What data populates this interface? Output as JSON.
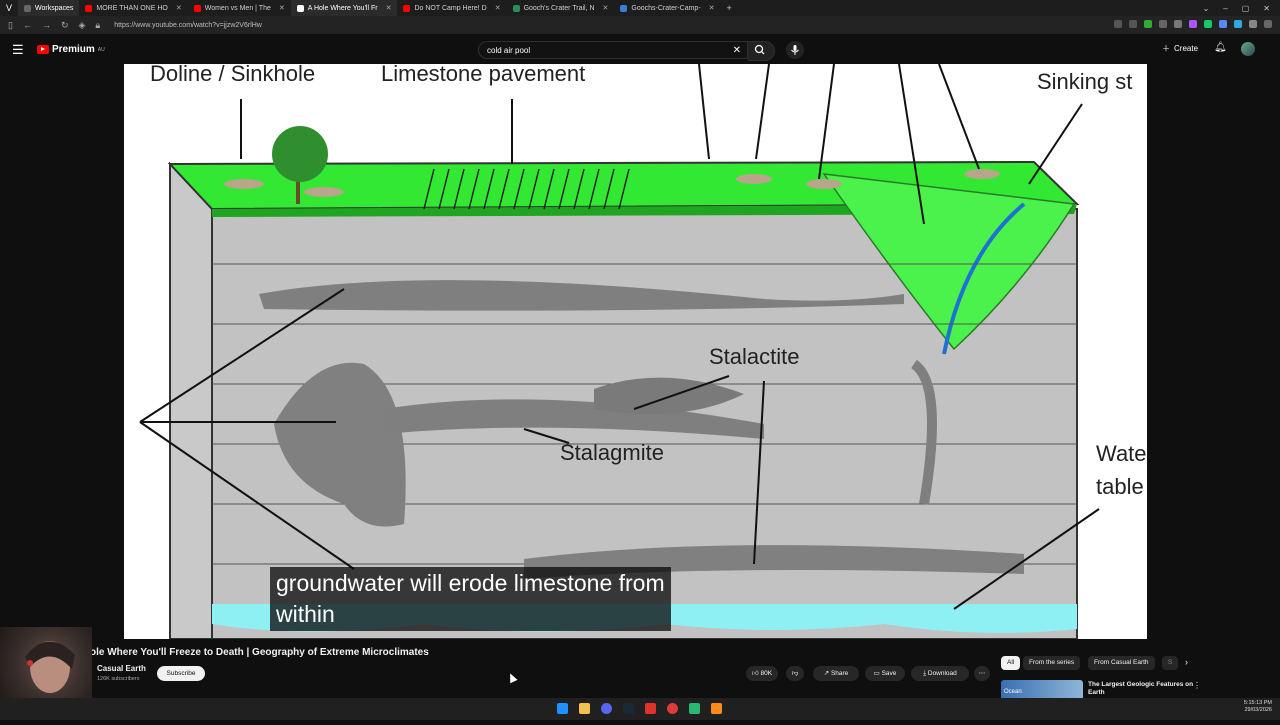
{
  "browser": {
    "tabs": [
      {
        "label": "Workspaces",
        "color": "#555555"
      },
      {
        "label": "MORE THAN ONE HO",
        "color": "#ff0000"
      },
      {
        "label": "Women vs Men | The",
        "color": "#ff0000"
      },
      {
        "label": "A Hole Where You'll Fr",
        "color": "#ff0000"
      },
      {
        "label": "Do NOT Camp Here! D",
        "color": "#ff0000"
      },
      {
        "label": "Gooch's Crater Trail, N",
        "color": "#2e8b57"
      },
      {
        "label": "Goochs-Crater-Camp-",
        "color": "#3b7dd8"
      }
    ],
    "url": "https://www.youtube.com/watch?v=jjzw2V6rlHw"
  },
  "youtube": {
    "premium_label": "Premium",
    "region": "AU",
    "search_value": "cold air pool",
    "create_label": "Create"
  },
  "diagram": {
    "labels": {
      "doline": "Doline / Sinkhole",
      "pavement": "Limestone pavement",
      "sinking": "Sinking st",
      "stalactite": "Stalactite",
      "stalagmite": "Stalagmite",
      "water1": "Wate",
      "water2": "table"
    }
  },
  "subtitle": {
    "line1": "groundwater will erode limestone from",
    "line2": "within"
  },
  "video": {
    "title": "ole Where You'll Freeze to Death | Geography of Extreme Microclimates",
    "channel": "Casual Earth",
    "subscribers": "126K subscribers",
    "subscribe_label": "Subscribe",
    "likes": "80",
    "share_label": "Share",
    "save_label": "Save",
    "download_label": "Download"
  },
  "chips": [
    "All",
    "From the series",
    "From Casual Earth"
  ],
  "chip_partial": "S",
  "recommendation": {
    "title": "The Largest Geologic Features on Earth",
    "thumb_label": "Ocean"
  },
  "taskbar": {
    "time": "5:15:13 PM",
    "date": "29/03/2026"
  }
}
